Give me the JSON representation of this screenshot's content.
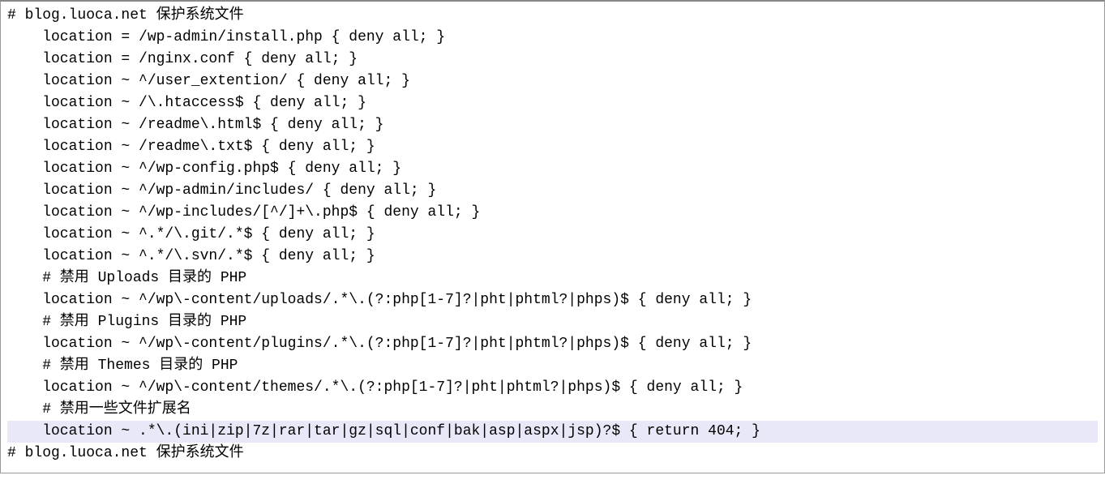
{
  "code": {
    "lines": [
      {
        "indent": 0,
        "hl": false,
        "text": "# blog.luoca.net 保护系统文件"
      },
      {
        "indent": 1,
        "hl": false,
        "text": "location = /wp-admin/install.php { deny all; }"
      },
      {
        "indent": 1,
        "hl": false,
        "text": "location = /nginx.conf { deny all; }"
      },
      {
        "indent": 1,
        "hl": false,
        "text": "location ~ ^/user_extention/ { deny all; }"
      },
      {
        "indent": 1,
        "hl": false,
        "text": "location ~ /\\.htaccess$ { deny all; }"
      },
      {
        "indent": 1,
        "hl": false,
        "text": "location ~ /readme\\.html$ { deny all; }"
      },
      {
        "indent": 1,
        "hl": false,
        "text": "location ~ /readme\\.txt$ { deny all; }"
      },
      {
        "indent": 1,
        "hl": false,
        "text": "location ~ ^/wp-config.php$ { deny all; }"
      },
      {
        "indent": 1,
        "hl": false,
        "text": "location ~ ^/wp-admin/includes/ { deny all; }"
      },
      {
        "indent": 1,
        "hl": false,
        "text": "location ~ ^/wp-includes/[^/]+\\.php$ { deny all; }"
      },
      {
        "indent": 1,
        "hl": false,
        "text": "location ~ ^.*/\\.git/.*$ { deny all; }"
      },
      {
        "indent": 1,
        "hl": false,
        "text": "location ~ ^.*/\\.svn/.*$ { deny all; }"
      },
      {
        "indent": 1,
        "hl": false,
        "text": "# 禁用 Uploads 目录的 PHP"
      },
      {
        "indent": 1,
        "hl": false,
        "text": "location ~ ^/wp\\-content/uploads/.*\\.(?:php[1-7]?|pht|phtml?|phps)$ { deny all; }"
      },
      {
        "indent": 1,
        "hl": false,
        "text": "# 禁用 Plugins 目录的 PHP"
      },
      {
        "indent": 1,
        "hl": false,
        "text": "location ~ ^/wp\\-content/plugins/.*\\.(?:php[1-7]?|pht|phtml?|phps)$ { deny all; }"
      },
      {
        "indent": 1,
        "hl": false,
        "text": "# 禁用 Themes 目录的 PHP"
      },
      {
        "indent": 1,
        "hl": false,
        "text": "location ~ ^/wp\\-content/themes/.*\\.(?:php[1-7]?|pht|phtml?|phps)$ { deny all; }"
      },
      {
        "indent": 1,
        "hl": false,
        "text": "# 禁用一些文件扩展名"
      },
      {
        "indent": 1,
        "hl": true,
        "text": "location ~ .*\\.(ini|zip|7z|rar|tar|gz|sql|conf|bak|asp|aspx|jsp)?$ { return 404; }"
      },
      {
        "indent": 0,
        "hl": false,
        "text": "# blog.luoca.net 保护系统文件"
      }
    ]
  }
}
